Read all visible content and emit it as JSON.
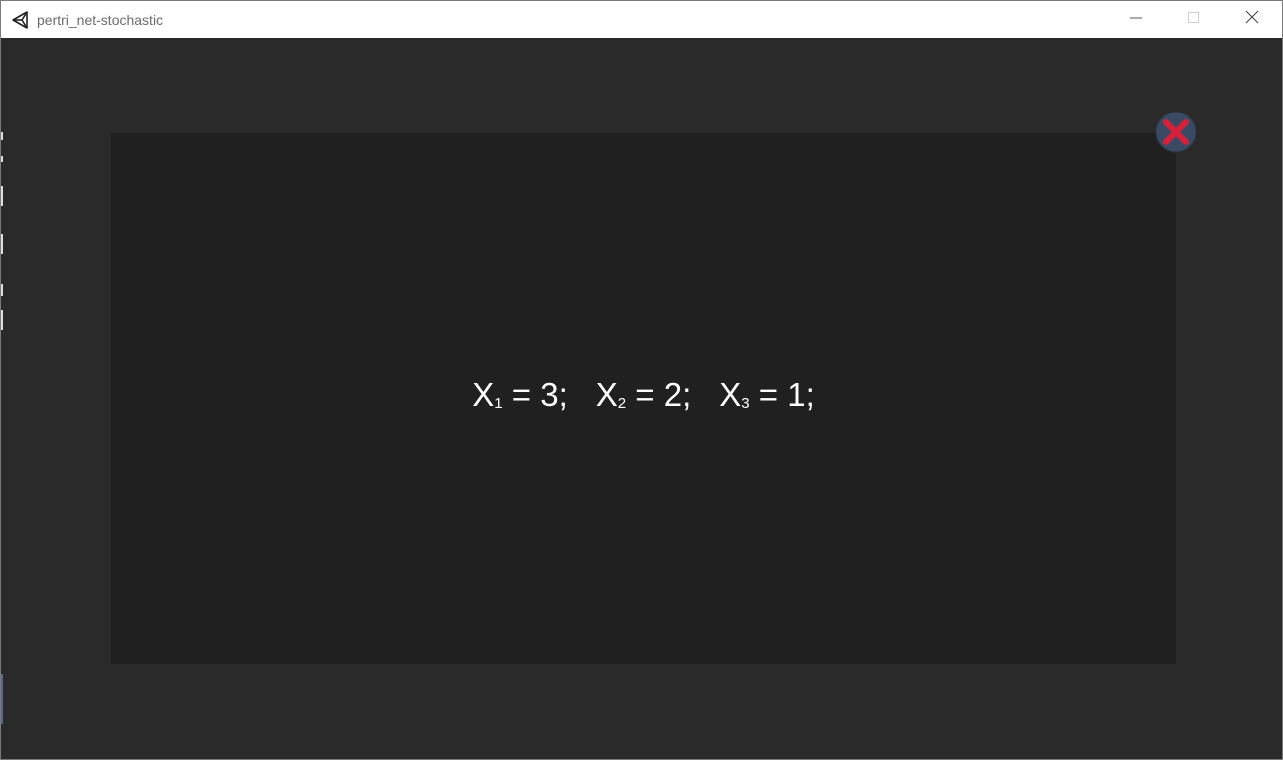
{
  "window": {
    "title": "pertri_net-stochastic"
  },
  "icons": {
    "app": "unity-logo-icon",
    "minimize": "minimize-icon",
    "maximize": "maximize-icon",
    "close": "close-icon",
    "panel_close": "red-x-close-icon"
  },
  "colors": {
    "titlebar_bg": "#ffffff",
    "client_bg": "#2a2a2a",
    "panel_bg": "#202020",
    "text": "#ffffff",
    "close_x": "#d8203a",
    "close_circle": "#3b4a63"
  },
  "panel": {
    "terms": [
      {
        "var": "X",
        "sub": "1",
        "rest": " = 3;"
      },
      {
        "var": "X",
        "sub": "2",
        "rest": " = 2;"
      },
      {
        "var": "X",
        "sub": "3",
        "rest": " = 1;"
      }
    ]
  }
}
